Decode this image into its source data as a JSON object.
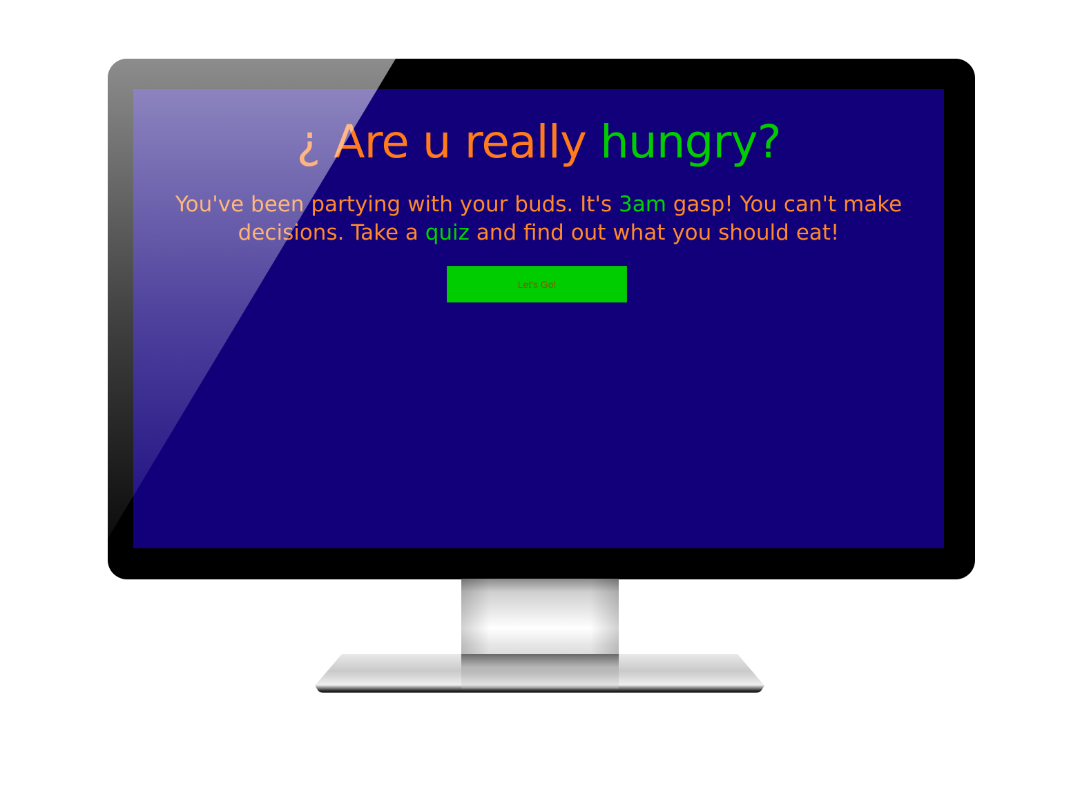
{
  "colors": {
    "screen_bg": "#12007a",
    "headline_orange": "#ff7b1c",
    "headline_green": "#00cd00",
    "intro_orange": "#ff8a2a",
    "intro_green": "#00d400",
    "button_bg": "#00cd00",
    "button_text": "#8a4e00",
    "bezel": "#000000"
  },
  "page": {
    "headline": {
      "part1": "¿ Are u really ",
      "part2": "hungry?"
    },
    "intro": {
      "seg1": "You've been partying with your buds. It's ",
      "seg2": "3am",
      "seg3": " gasp! You can't make decisions. Take a ",
      "seg4": "quiz",
      "seg5": " and find out what you should eat!"
    },
    "cta_label": "Let's Go!"
  },
  "icons": {
    "monitor": "monitor-icon"
  }
}
